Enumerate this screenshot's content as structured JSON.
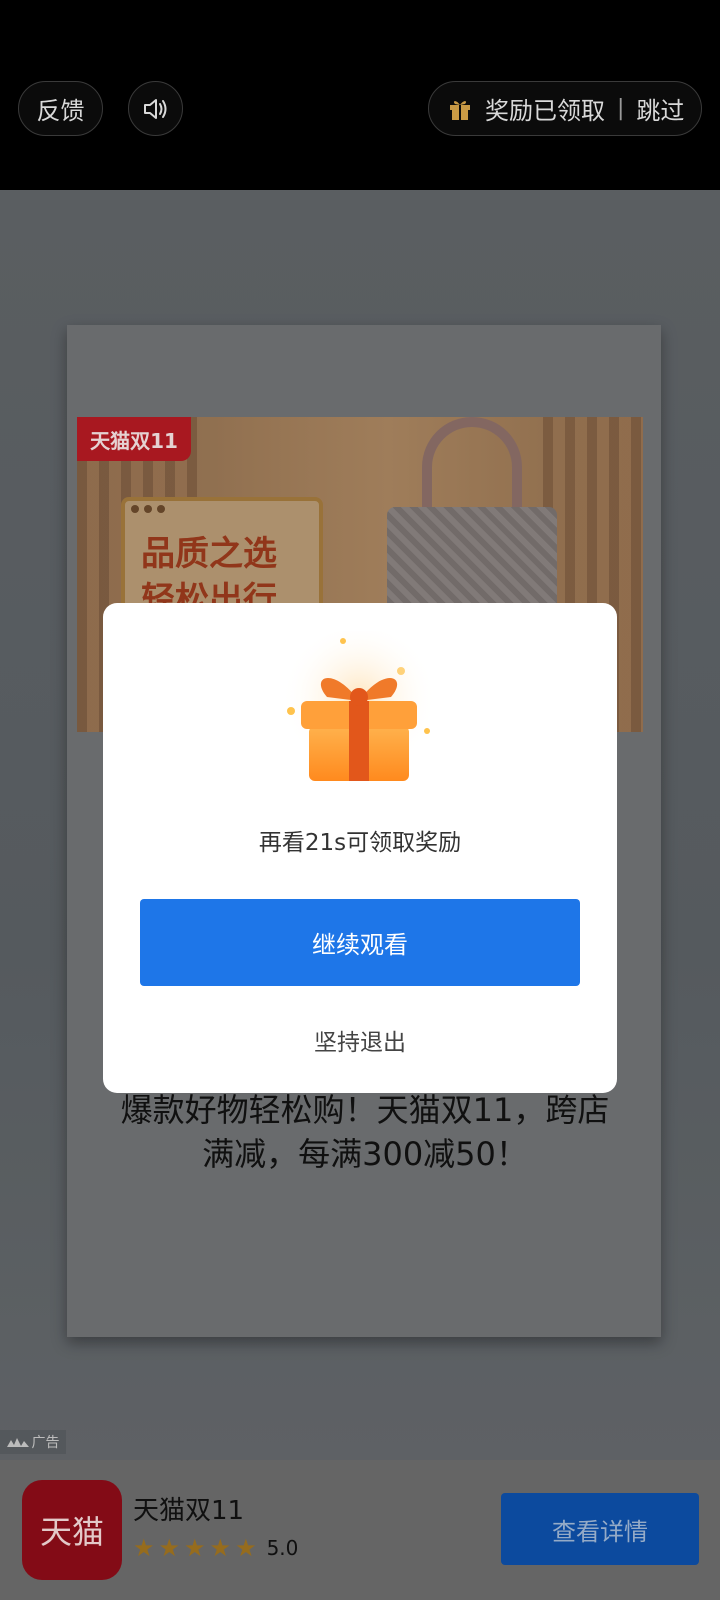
{
  "topbar": {
    "feedback_label": "反馈",
    "sound_icon": "speaker-icon",
    "reward_status": "奖励已领取",
    "separator": "|",
    "skip_label": "跳过"
  },
  "ad": {
    "banner_tag": "天猫双11",
    "banner_headline_1": "品质之选",
    "banner_headline_2": "轻松出行",
    "slogan_line1": "爆款好物轻松购！天猫双11，跨店",
    "slogan_line2": "满减，每满300减50！",
    "ad_label": "广告"
  },
  "bottom_bar": {
    "app_icon_text": "天猫",
    "app_name": "天猫双11",
    "rating": "5.0",
    "stars": 5,
    "detail_button": "查看详情"
  },
  "modal": {
    "message": "再看21s可领取奖励",
    "continue_button": "继续观看",
    "exit_link": "坚持退出"
  },
  "colors": {
    "primary_button": "#1e76e8",
    "tmall_red": "#b31a23"
  }
}
